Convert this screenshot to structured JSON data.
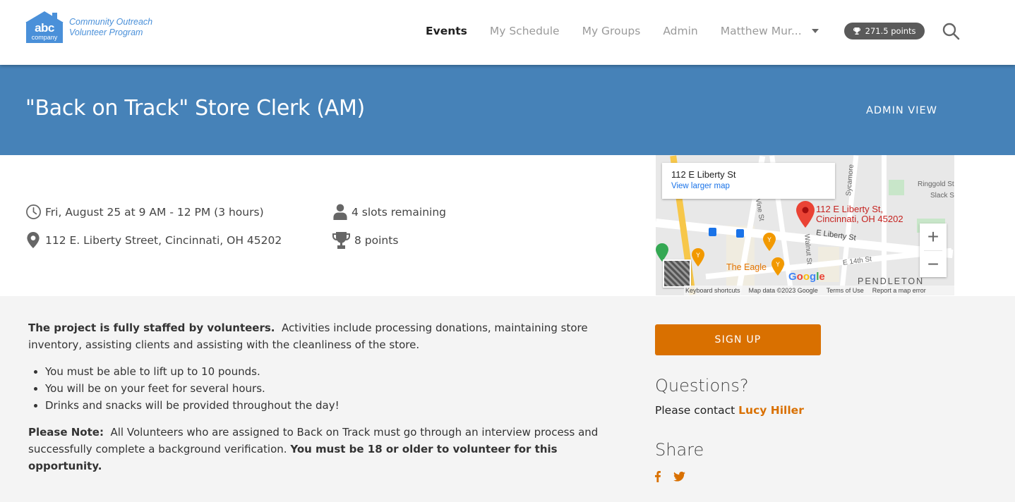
{
  "brand": {
    "logo_main": "abc",
    "logo_sub": "company",
    "program_line1": "Community Outreach",
    "program_line2": "Volunteer Program",
    "accent_color": "#4a90d9"
  },
  "nav": {
    "items": [
      {
        "label": "Events",
        "active": true
      },
      {
        "label": "My Schedule",
        "active": false
      },
      {
        "label": "My Groups",
        "active": false
      },
      {
        "label": "Admin",
        "active": false
      }
    ],
    "user_name": "Matthew Mur...",
    "points_badge": "271.5 points",
    "search_icon": "search-icon"
  },
  "header": {
    "title": "\"Back on Track\" Store Clerk (AM)",
    "admin_view": "ADMIN VIEW",
    "band_color": "#4682b8"
  },
  "event": {
    "datetime": "Fri, August 25 at 9 AM - 12 PM (3 hours)",
    "address": "112 E. Liberty Street, Cincinnati, OH 45202",
    "slots": "4 slots remaining",
    "points": "8 points"
  },
  "map": {
    "card_address": "112 E Liberty St",
    "view_larger": "View larger map",
    "pin_label_line1": "112 E Liberty St,",
    "pin_label_line2": "Cincinnati, OH 45202",
    "labels": {
      "liberty": "E Liberty St",
      "vine": "Vine St",
      "walnut": "Walnut St",
      "sycamore": "Sycamore",
      "fourteenth": "E 14th St",
      "ringgold": "Ringgold St",
      "slack": "Slack St",
      "eagle": "The Eagle",
      "pendleton": "PENDLETON"
    },
    "zoom_in": "+",
    "zoom_out": "−",
    "google": "Google",
    "footer": [
      "Keyboard shortcuts",
      "Map data ©2023 Google",
      "Terms of Use",
      "Report a map error"
    ]
  },
  "description": {
    "intro_bold": "The project is fully staffed by volunteers.",
    "intro_text": "  Activities include processing donations, maintaining store inventory, assisting clients and assisting with the cleanliness of the store.",
    "bullets": [
      "You must be able to lift up to 10 pounds.",
      "You will be on your feet for several hours.",
      "Drinks and snacks will be provided throughout the day!"
    ],
    "note_label": "Please Note:",
    "note_text": "  All Volunteers who are assigned to Back on Track must go through an interview process and successfully complete a background verification. ",
    "note_bold": "You must be 18 or older to volunteer for this opportunity."
  },
  "sidebar": {
    "signup_label": "SIGN UP",
    "signup_color": "#d97000",
    "questions_heading": "Questions?",
    "contact_prefix": "Please contact ",
    "contact_name": "Lucy Hiller",
    "share_heading": "Share",
    "share_icons": [
      "facebook-icon",
      "twitter-icon"
    ]
  }
}
